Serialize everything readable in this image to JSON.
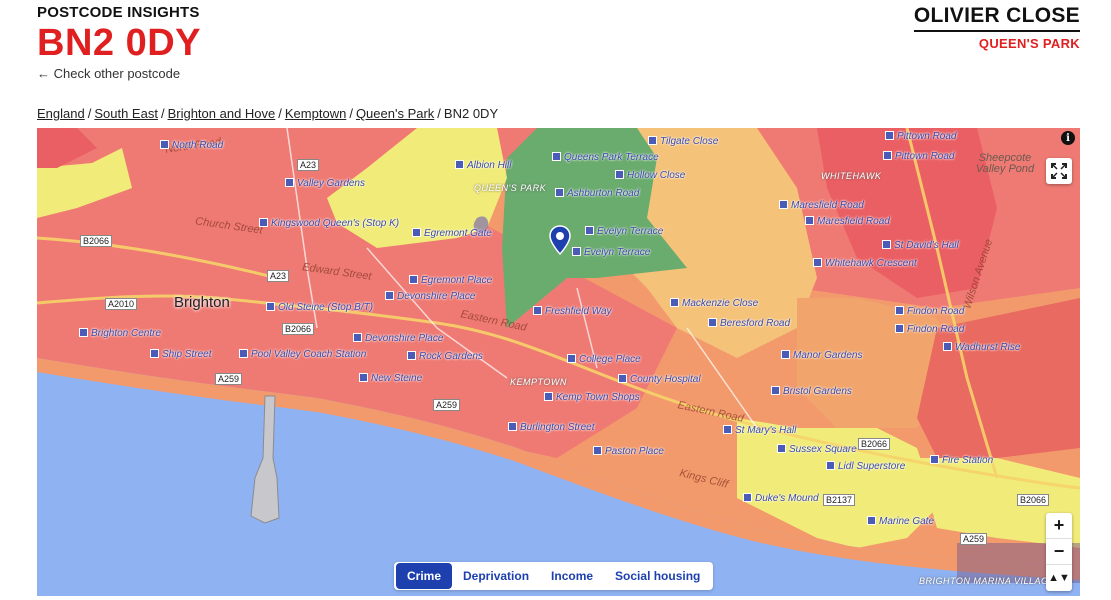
{
  "header": {
    "eyebrow": "POSTCODE INSIGHTS",
    "postcode": "BN2 0DY",
    "back_link": "← Check other postcode",
    "street": "OLIVIER CLOSE",
    "area": "QUEEN'S PARK"
  },
  "breadcrumb": {
    "items": [
      "England",
      "South East",
      "Brighton and Hove",
      "Kemptown",
      "Queen's Park"
    ],
    "current": "BN2 0DY",
    "separator": "/"
  },
  "map": {
    "colors": {
      "sea": "#8fb2f2",
      "red": "#ef7a73",
      "orange": "#f39a6c",
      "yellow": "#f1ec79",
      "green": "#6aab6e",
      "amber": "#f5c27a"
    },
    "town_label": "Brighton",
    "place_labels": [
      "QUEEN'S PARK",
      "WHITEHAWK",
      "KEMPTOWN",
      "BRIGHTON MARINA VILLAGE"
    ],
    "landmark": "Sheepcote Valley Pond",
    "road_labels": [
      "A23",
      "B2066",
      "A2010",
      "A259",
      "B2137"
    ],
    "street_labels": [
      "North Road",
      "Church Street",
      "Edward Street",
      "Eastern Road",
      "Eastern Road",
      "Kings Cliff",
      "Wilson Avenue"
    ],
    "stops": [
      "North Road",
      "Albion Hill",
      "Queens Park Terrace",
      "Tilgate Close",
      "Pittown Road",
      "Valley Gardens",
      "Hollow Close",
      "Pittown Road",
      "Kingswood Queen's (Stop K)",
      "Egremont Gate",
      "Ashburton Road",
      "Maresfield Road",
      "Maresfield Road",
      "Evelyn Terrace",
      "Evelyn Terrace",
      "St David's Hall",
      "Whitehawk Crescent",
      "Egremont Place",
      "Old Steine (Stop B/T)",
      "Devonshire Place",
      "Freshfield Way",
      "Mackenzie Close",
      "Findon Road",
      "Brighton Centre",
      "Devonshire Place",
      "Beresford Road",
      "Findon Road",
      "Ship Street",
      "Pool Valley Coach Station",
      "Rock Gardens",
      "College Place",
      "Manor Gardens",
      "Wadhurst Rise",
      "New Steine",
      "County Hospital",
      "Kemp Town Shops",
      "Bristol Gardens",
      "Burlington Street",
      "St Mary's Hall",
      "Paston Place",
      "Sussex Square",
      "Fire Station",
      "Lidl Superstore",
      "Duke's Mound",
      "Marine Gate"
    ],
    "pin_label": "BN2 0DY"
  },
  "tabs": [
    "Crime",
    "Deprivation",
    "Income",
    "Social housing"
  ],
  "active_tab": "Crime",
  "controls": {
    "zoom_in": "+",
    "zoom_out": "−",
    "reset_north": "▲▼",
    "info": "i"
  }
}
